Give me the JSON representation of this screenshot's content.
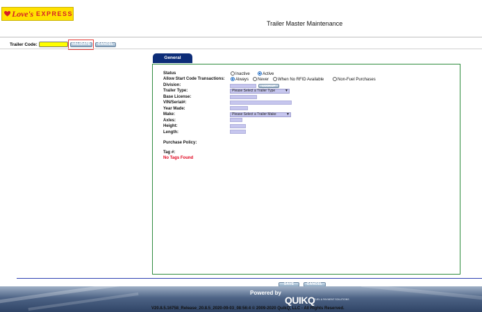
{
  "header": {
    "logo_brand": "Love's",
    "logo_express": "EXPRESS",
    "page_title": "Trailer Master Maintenance"
  },
  "trailer_code_bar": {
    "label": "Trailer Code:",
    "input_value": "",
    "validate_label": "VALIDATE",
    "cancel_label": "CANCEL"
  },
  "tabs": [
    {
      "label": "General",
      "active": true
    }
  ],
  "form": {
    "status": {
      "label": "Status",
      "options": [
        {
          "label": "Inactive",
          "selected": false
        },
        {
          "label": "Active",
          "selected": true
        }
      ]
    },
    "allow_start_code": {
      "label": "Allow Start Code Transactions:",
      "options": [
        {
          "label": "Always",
          "selected": true
        },
        {
          "label": "Never",
          "selected": false
        },
        {
          "label": "When No RFID Available",
          "selected": false
        },
        {
          "label": "Non-Fuel Purchases",
          "selected": false
        }
      ]
    },
    "division": {
      "label": "Division:",
      "value": "",
      "lookup_label": "LOOKUP"
    },
    "trailer_type": {
      "label": "Trailer Type:",
      "selected": "Please Select a Trailer Type"
    },
    "base_license": {
      "label": "Base License:",
      "value": ""
    },
    "vin_serial": {
      "label": "VIN/Serial#:",
      "value": ""
    },
    "year_made": {
      "label": "Year Made:",
      "value": ""
    },
    "make": {
      "label": "Make:",
      "selected": "Please Select a Trailer Make"
    },
    "axles": {
      "label": "Axles:",
      "value": ""
    },
    "height": {
      "label": "Height:",
      "value": ""
    },
    "length": {
      "label": "Length:",
      "value": ""
    },
    "purchase_policy": {
      "label": "Purchase Policy:"
    },
    "tag": {
      "label": "Tag #:",
      "empty_text": "No Tags Found"
    }
  },
  "bottom_actions": {
    "save_label": "SAVE",
    "cancel_label": "CANCEL"
  },
  "footer": {
    "powered_by": "Powered by",
    "quikq_logo": "QUIKQ",
    "quikq_tagline": "FUEL & PAYMENT SOLUTIONS",
    "version_text": "V20.8.5.16758_Release_20.8.5_2020-09-03_08:56:4 © 2009-2020 QuikQ, LLC - All Rights Reserved."
  },
  "colors": {
    "logo_yellow": "#ffe100",
    "brand_red": "#d51f26",
    "tab_navy": "#0d2d78",
    "panel_border_green": "#2e8b3d",
    "input_lavender": "#c6c6ee",
    "trailer_code_yellow": "#ffff00",
    "highlight_red": "#e53935",
    "error_red": "#e0001b"
  }
}
